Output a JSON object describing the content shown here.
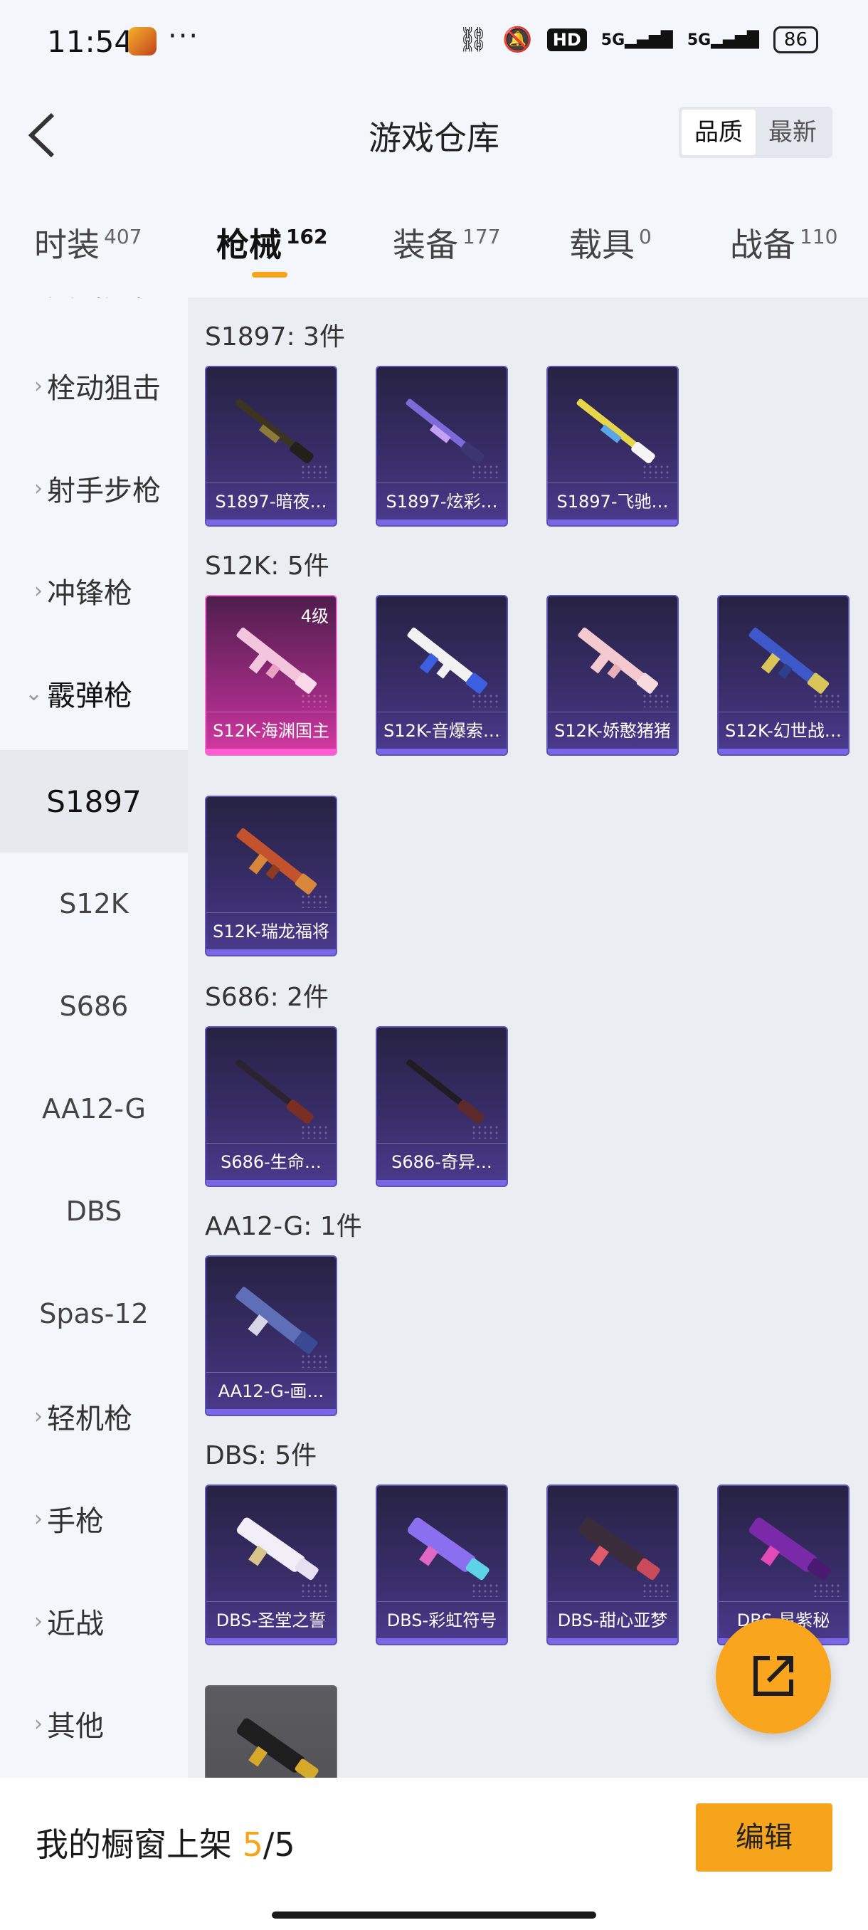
{
  "status_bar": {
    "time": "11:54",
    "more": "···",
    "hd": "HD",
    "signal1": "5G",
    "signal2": "5G",
    "battery": "86"
  },
  "header": {
    "title": "游戏仓库",
    "sort_options": [
      "品质",
      "最新"
    ]
  },
  "tabs": [
    {
      "label": "时装",
      "count": "407"
    },
    {
      "label": "枪械",
      "count": "162"
    },
    {
      "label": "装备",
      "count": "177"
    },
    {
      "label": "载具",
      "count": "0"
    },
    {
      "label": "战备",
      "count": "110"
    }
  ],
  "sidebar": {
    "cut_item": "突击步枪",
    "categories": [
      "栓动狙击",
      "射手步枪",
      "冲锋枪",
      "霰弹枪"
    ],
    "subcategories": [
      "S1897",
      "S12K",
      "S686",
      "AA12-G",
      "DBS",
      "Spas-12"
    ],
    "more_categories": [
      "轻机枪",
      "手枪",
      "近战",
      "其他"
    ]
  },
  "groups": [
    {
      "title": "S1897: 3件",
      "items": [
        {
          "name": "S1897-暗夜…"
        },
        {
          "name": "S1897-炫彩…"
        },
        {
          "name": "S1897-飞驰…"
        }
      ]
    },
    {
      "title": "S12K: 5件",
      "items": [
        {
          "name": "S12K-海渊国主",
          "level": "4级"
        },
        {
          "name": "S12K-音爆索…"
        },
        {
          "name": "S12K-娇憨猪猪"
        },
        {
          "name": "S12K-幻世战…"
        },
        {
          "name": "S12K-瑞龙福将"
        }
      ]
    },
    {
      "title": "S686: 2件",
      "items": [
        {
          "name": "S686-生命…"
        },
        {
          "name": "S686-奇异…"
        }
      ]
    },
    {
      "title": "AA12-G: 1件",
      "items": [
        {
          "name": "AA12-G-画…"
        }
      ]
    },
    {
      "title": "DBS: 5件",
      "items": [
        {
          "name": "DBS-圣堂之誓"
        },
        {
          "name": "DBS-彩虹符号"
        },
        {
          "name": "DBS-甜心亚梦"
        },
        {
          "name": "DBS-星紫秘"
        }
      ]
    }
  ],
  "bottom_bar": {
    "label": "我的橱窗上架 ",
    "current": "5",
    "total": "/5",
    "edit": "编辑"
  },
  "colors": {
    "accent": "#f5a41c",
    "card_purple": "#3b2f6f",
    "card_pink": "#d63aa3"
  }
}
